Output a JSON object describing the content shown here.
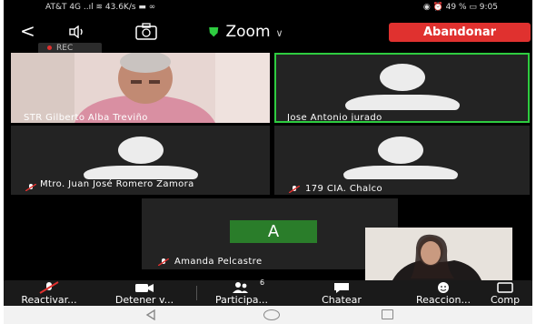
{
  "status_bar": {
    "left_text": "AT&T 4G ..ıl ≋ 43.6K/s ▬ ∞",
    "right_text": "◉ ⏰ 49 % ▭ 9:05"
  },
  "toolbar": {
    "app_title": "Zoom",
    "leave_label": "Abandonar",
    "back_glyph": "<"
  },
  "recording": {
    "label": "REC"
  },
  "participants": {
    "gilberto": {
      "name": "STR   Gilberto Alba Treviño"
    },
    "jose": {
      "name": "Jose Antonio jurado"
    },
    "juan": {
      "name": "Mtro. Juan José Romero Zamora"
    },
    "cia": {
      "name": "179 CIA. Chalco"
    },
    "amanda": {
      "name": "Amanda Pelcastre",
      "initial": "A"
    }
  },
  "bottom_bar": {
    "unmute": "Reactivar...",
    "stop_video": "Detener v...",
    "participants": "Participa...",
    "participants_count": "6",
    "chat": "Chatear",
    "reactions": "Reaccion...",
    "share": "Comp"
  },
  "colors": {
    "accent_green": "#2ecc40",
    "leave_red": "#e0312f",
    "avatar_green": "#2a7d2a"
  }
}
